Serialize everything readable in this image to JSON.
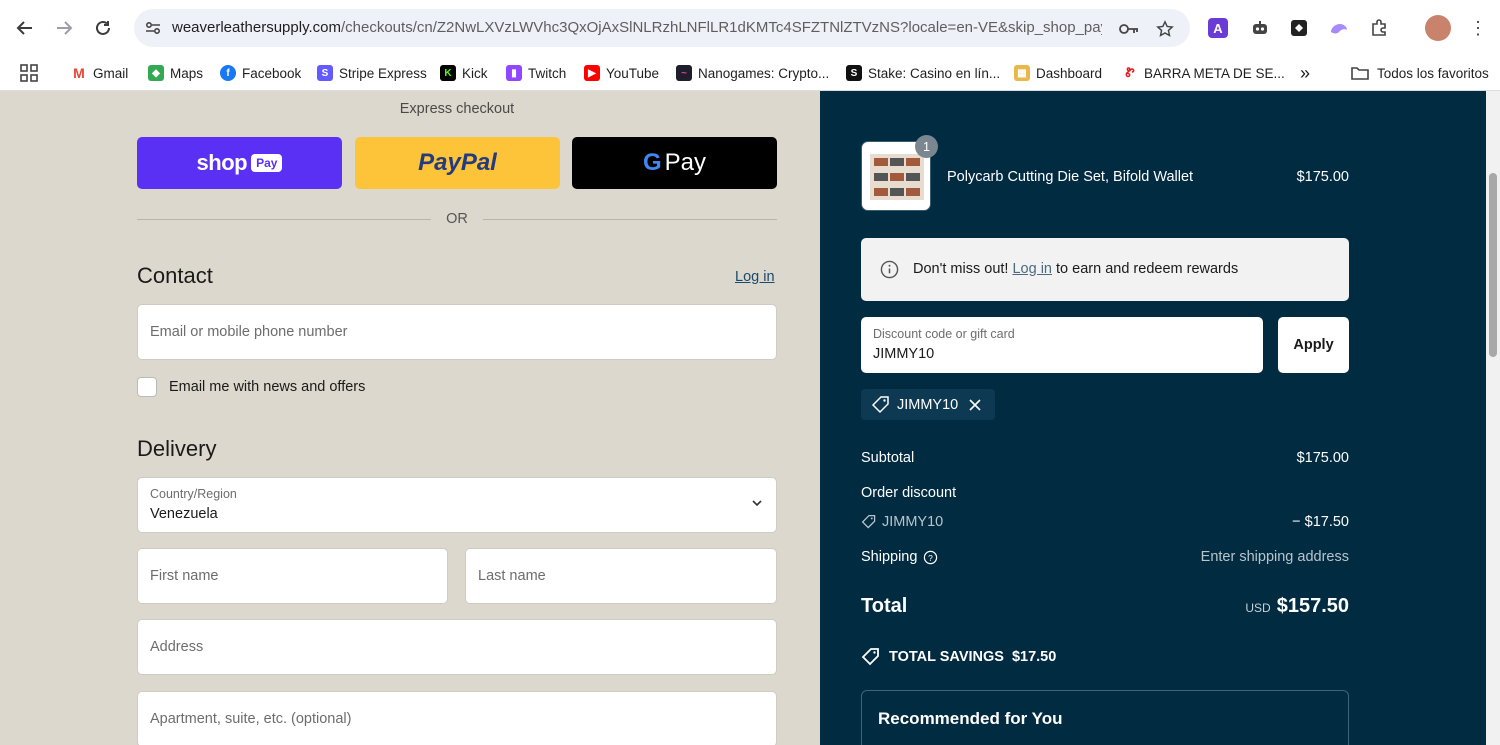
{
  "browser": {
    "url_host": "weaverleathersupply.com",
    "url_path": "/checkouts/cn/Z2NwLXVzLWVhc3QxOjAxSlNLRzhLNFlLR1dKMTc4SFZTNlZTVzNS?locale=en-VE&skip_shop_pay=..."
  },
  "bookmarks": [
    {
      "label": "Gmail"
    },
    {
      "label": "Maps"
    },
    {
      "label": "Facebook"
    },
    {
      "label": "Stripe Express"
    },
    {
      "label": "Kick"
    },
    {
      "label": "Twitch"
    },
    {
      "label": "YouTube"
    },
    {
      "label": "Nanogames: Crypto..."
    },
    {
      "label": "Stake: Casino en lín..."
    },
    {
      "label": "Dashboard"
    },
    {
      "label": "BARRA META DE SE..."
    }
  ],
  "bookmarks_more": "»",
  "all_bookmarks": "Todos los favoritos",
  "express": {
    "title": "Express checkout",
    "shop_pay": "shop",
    "shop_pay_badge": "Pay",
    "paypal": "PayPal",
    "gpay": "Pay",
    "or": "OR"
  },
  "contact": {
    "heading": "Contact",
    "login": "Log in",
    "email_placeholder": "Email or mobile phone number",
    "newsletter_label": "Email me with news and offers"
  },
  "delivery": {
    "heading": "Delivery",
    "country_label": "Country/Region",
    "country_value": "Venezuela",
    "first_name": "First name",
    "last_name": "Last name",
    "address": "Address",
    "apartment": "Apartment, suite, etc. (optional)"
  },
  "summary": {
    "qty": "1",
    "product_name": "Polycarb Cutting Die Set, Bifold Wallet",
    "product_price": "$175.00",
    "notice_prefix": "Don't miss out!",
    "notice_link": "Log in",
    "notice_suffix": "to earn and redeem rewards",
    "discount_label": "Discount code or gift card",
    "discount_value": "JIMMY10",
    "apply": "Apply",
    "chip_code": "JIMMY10",
    "subtotal_label": "Subtotal",
    "subtotal_value": "$175.00",
    "order_discount_label": "Order discount",
    "discount_code": "JIMMY10",
    "discount_amount": "− $17.50",
    "shipping_label": "Shipping",
    "shipping_value": "Enter shipping address",
    "total_label": "Total",
    "total_currency": "USD",
    "total_value": "$157.50",
    "savings_label": "TOTAL SAVINGS",
    "savings_value": "$17.50",
    "recommended": "Recommended for You"
  },
  "colors": {
    "shop_pay": "#5a31f4",
    "paypal": "#fdc43a",
    "summary_bg": "#012b41",
    "page_bg": "#dcd8cd"
  }
}
